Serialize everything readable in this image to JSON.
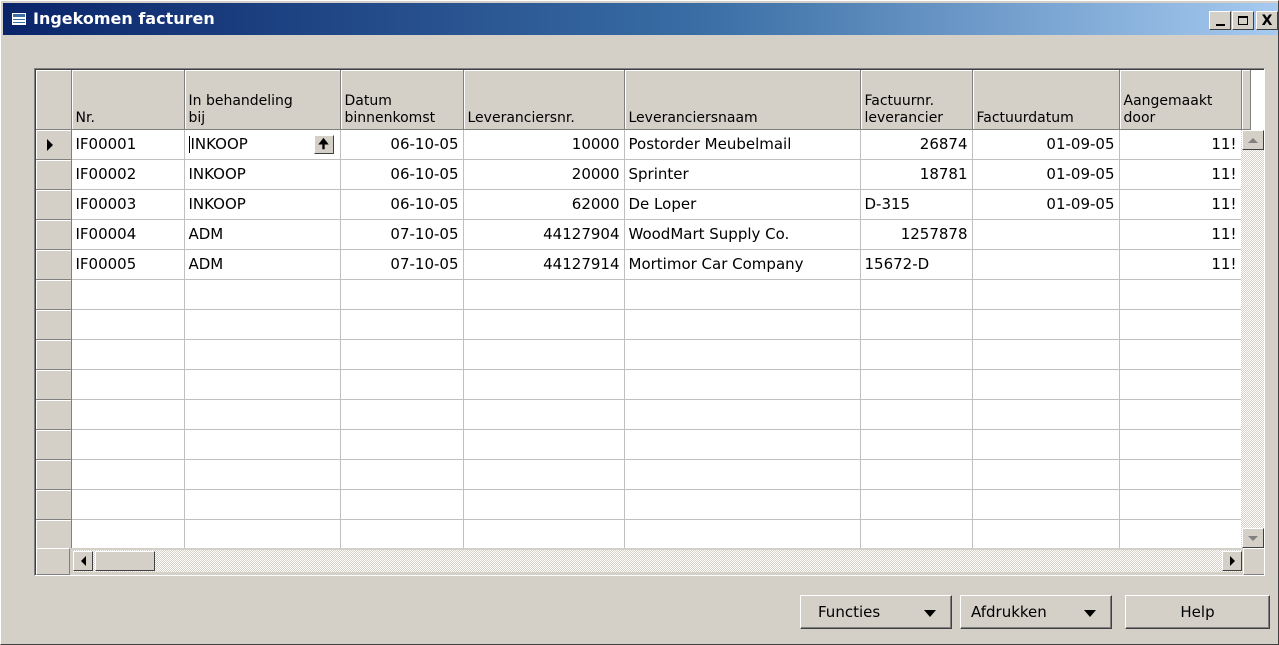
{
  "window": {
    "title": "Ingekomen facturen",
    "controls": {
      "minimize": "_",
      "maximize": "□",
      "close": "X"
    }
  },
  "table": {
    "columns": [
      "Nr.",
      "In behandeling\nbij",
      "Datum\nbinnenkomst",
      "Leveranciersnr.",
      "Leveranciersnaam",
      "Factuurnr.\nleverancier",
      "Factuurdatum",
      "Aangemaakt\ndoor"
    ],
    "rows": [
      [
        "IF00001",
        "INKOOP",
        "06-10-05",
        "10000",
        "Postorder Meubelmail",
        "26874",
        "01-09-05",
        "11!"
      ],
      [
        "IF00002",
        "INKOOP",
        "06-10-05",
        "20000",
        "Sprinter",
        "18781",
        "01-09-05",
        "11!"
      ],
      [
        "IF00003",
        "INKOOP",
        "06-10-05",
        "62000",
        "De Loper",
        "D-315",
        "01-09-05",
        "11!"
      ],
      [
        "IF00004",
        "ADM",
        "07-10-05",
        "44127904",
        "WoodMart Supply Co.",
        "1257878",
        "",
        "11!"
      ],
      [
        "IF00005",
        "ADM",
        "07-10-05",
        "44127914",
        "Mortimor Car Company",
        "15672-D",
        "",
        "11!"
      ]
    ],
    "empty_rows": 9,
    "assist_button_glyph": "🠉"
  },
  "buttons": {
    "functies": "Functies",
    "afdrukken": "Afdrukken",
    "help": "Help"
  },
  "icons": {
    "window": "table-window-icon",
    "current_row": "triangle-right-icon",
    "dropdown": "triangle-down-icon"
  }
}
